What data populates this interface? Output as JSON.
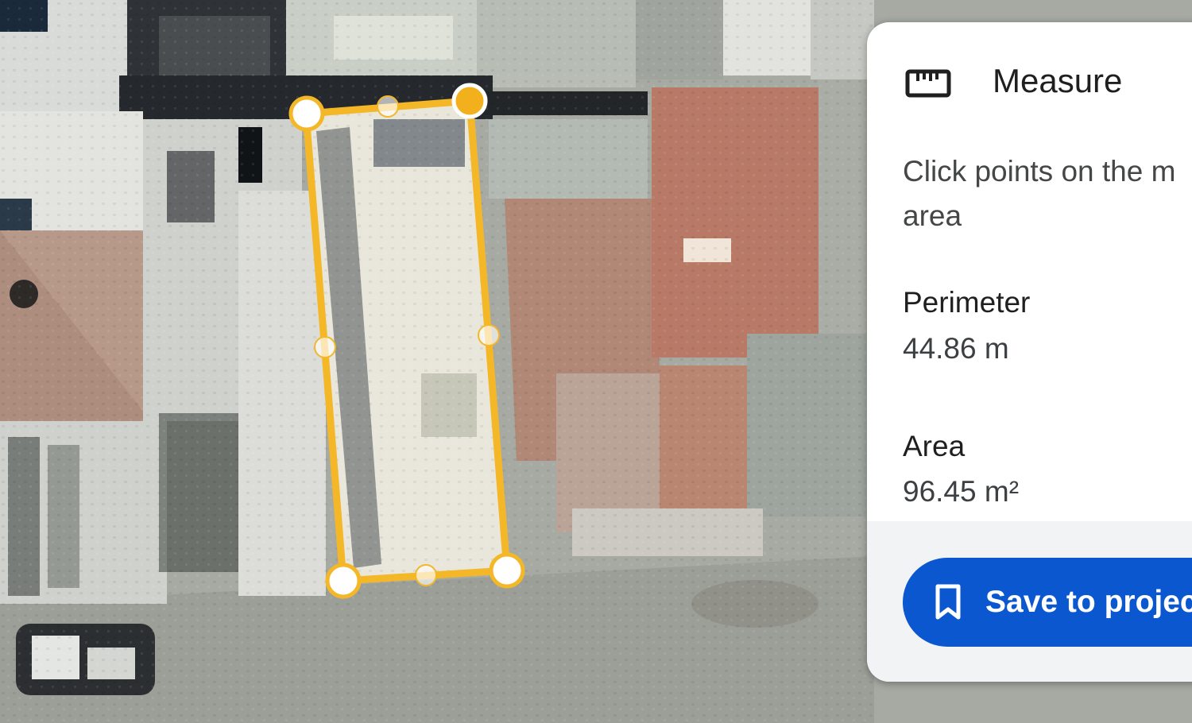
{
  "map": {
    "view": "satellite",
    "measured_shape": {
      "kind": "polygon",
      "stroke_color": "#f4b728",
      "vertex_color": "#ffffff",
      "active_vertex_color": "#f2b11c"
    }
  },
  "measure_panel": {
    "icon": "ruler-icon",
    "title": "Measure",
    "instruction": "Click points on the m area",
    "perimeter_label": "Perimeter",
    "perimeter_value": "44.86 m",
    "area_label": "Area",
    "area_value": "96.45 m²",
    "save_button": {
      "icon": "bookmark-icon",
      "label": "Save to projec"
    },
    "accent_color": "#0b57d0"
  }
}
